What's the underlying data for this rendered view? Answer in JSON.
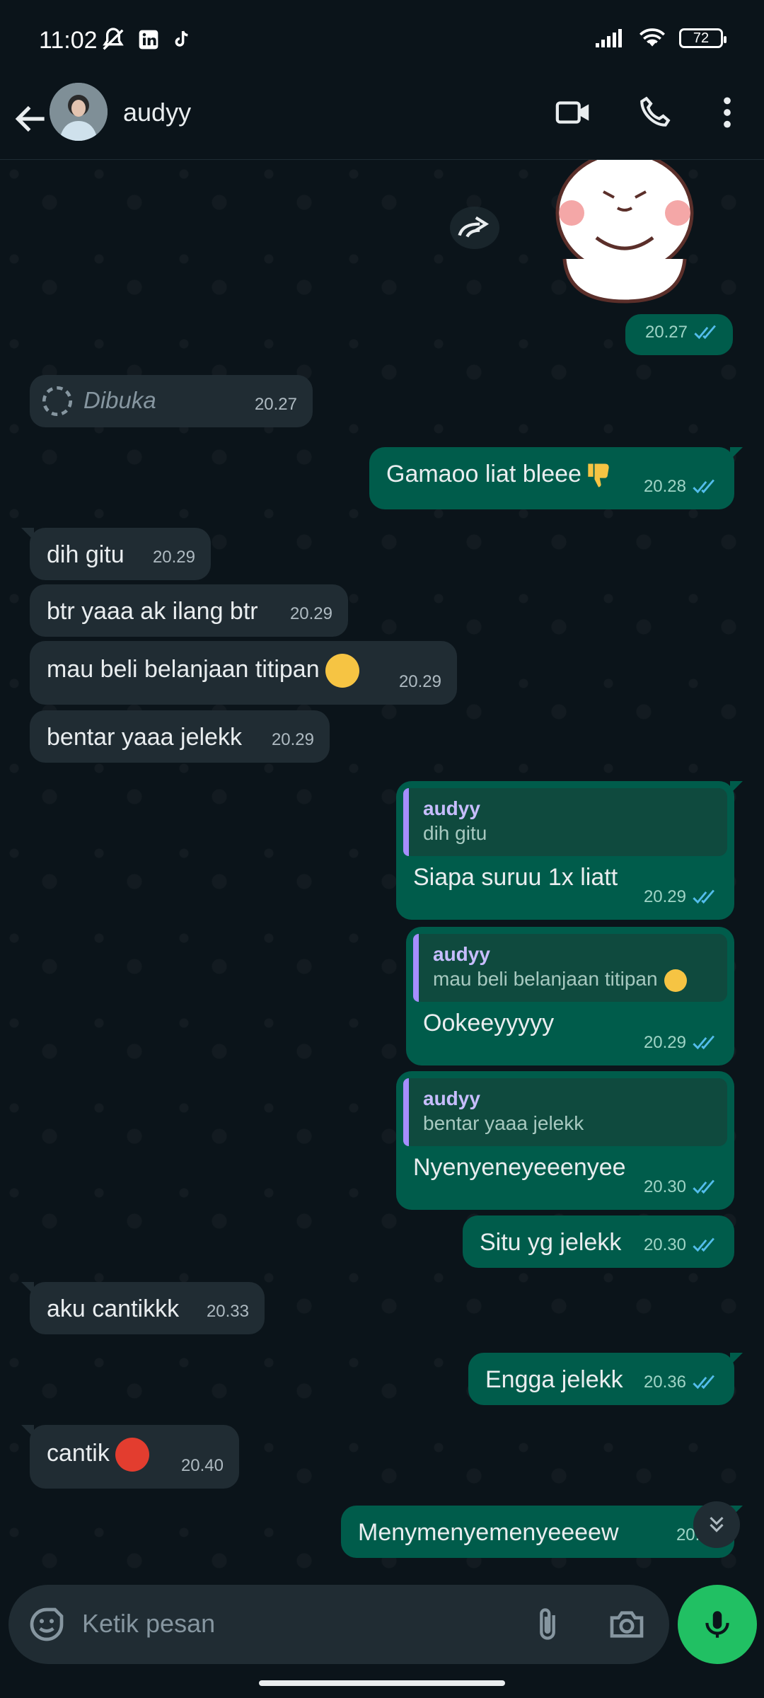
{
  "status_bar": {
    "time": "11:02",
    "battery": "72"
  },
  "header": {
    "contact_name": "audyy"
  },
  "messages": [
    {
      "id": "m0",
      "dir": "out",
      "type": "sticker",
      "time": "20.27"
    },
    {
      "id": "m1",
      "dir": "in",
      "type": "view_once",
      "text": "Dibuka",
      "time": "20.27"
    },
    {
      "id": "m2",
      "dir": "out",
      "text": "Gamaoo liat bleee",
      "time": "20.28"
    },
    {
      "id": "m3",
      "dir": "in",
      "text": "dih gitu",
      "time": "20.29"
    },
    {
      "id": "m4",
      "dir": "in",
      "text": "btr yaaa ak ilang btr",
      "time": "20.29"
    },
    {
      "id": "m5",
      "dir": "in",
      "text": "mau beli belanjaan titipan",
      "time": "20.29"
    },
    {
      "id": "m6",
      "dir": "in",
      "text": "bentar yaaa jelekk",
      "time": "20.29"
    },
    {
      "id": "m7",
      "dir": "out",
      "quote_name": "audyy",
      "quote_text": "dih gitu",
      "text": "Siapa suruu 1x liatt",
      "time": "20.29"
    },
    {
      "id": "m8",
      "dir": "out",
      "quote_name": "audyy",
      "quote_text": "mau beli belanjaan titipan",
      "text": "Ookeeyyyyy",
      "time": "20.29"
    },
    {
      "id": "m9",
      "dir": "out",
      "quote_name": "audyy",
      "quote_text": "bentar yaaa jelekk",
      "text": "Nyenyeneyeeenyee",
      "time": "20.30"
    },
    {
      "id": "m10",
      "dir": "out",
      "text": "Situ yg jelekk",
      "time": "20.30"
    },
    {
      "id": "m11",
      "dir": "in",
      "text": "aku cantikkk",
      "time": "20.33"
    },
    {
      "id": "m12",
      "dir": "out",
      "text": "Engga jelekk",
      "time": "20.36"
    },
    {
      "id": "m13",
      "dir": "in",
      "text": "cantik",
      "time": "20.40"
    },
    {
      "id": "m14",
      "dir": "out",
      "text": "Menymenyemenyeeeew",
      "time": "20.48"
    }
  ],
  "composer": {
    "placeholder": "Ketik pesan"
  },
  "colors": {
    "incoming": "#202c33",
    "outgoing": "#005c4b",
    "accent": "#21c063",
    "read_tick": "#53bdeb"
  }
}
